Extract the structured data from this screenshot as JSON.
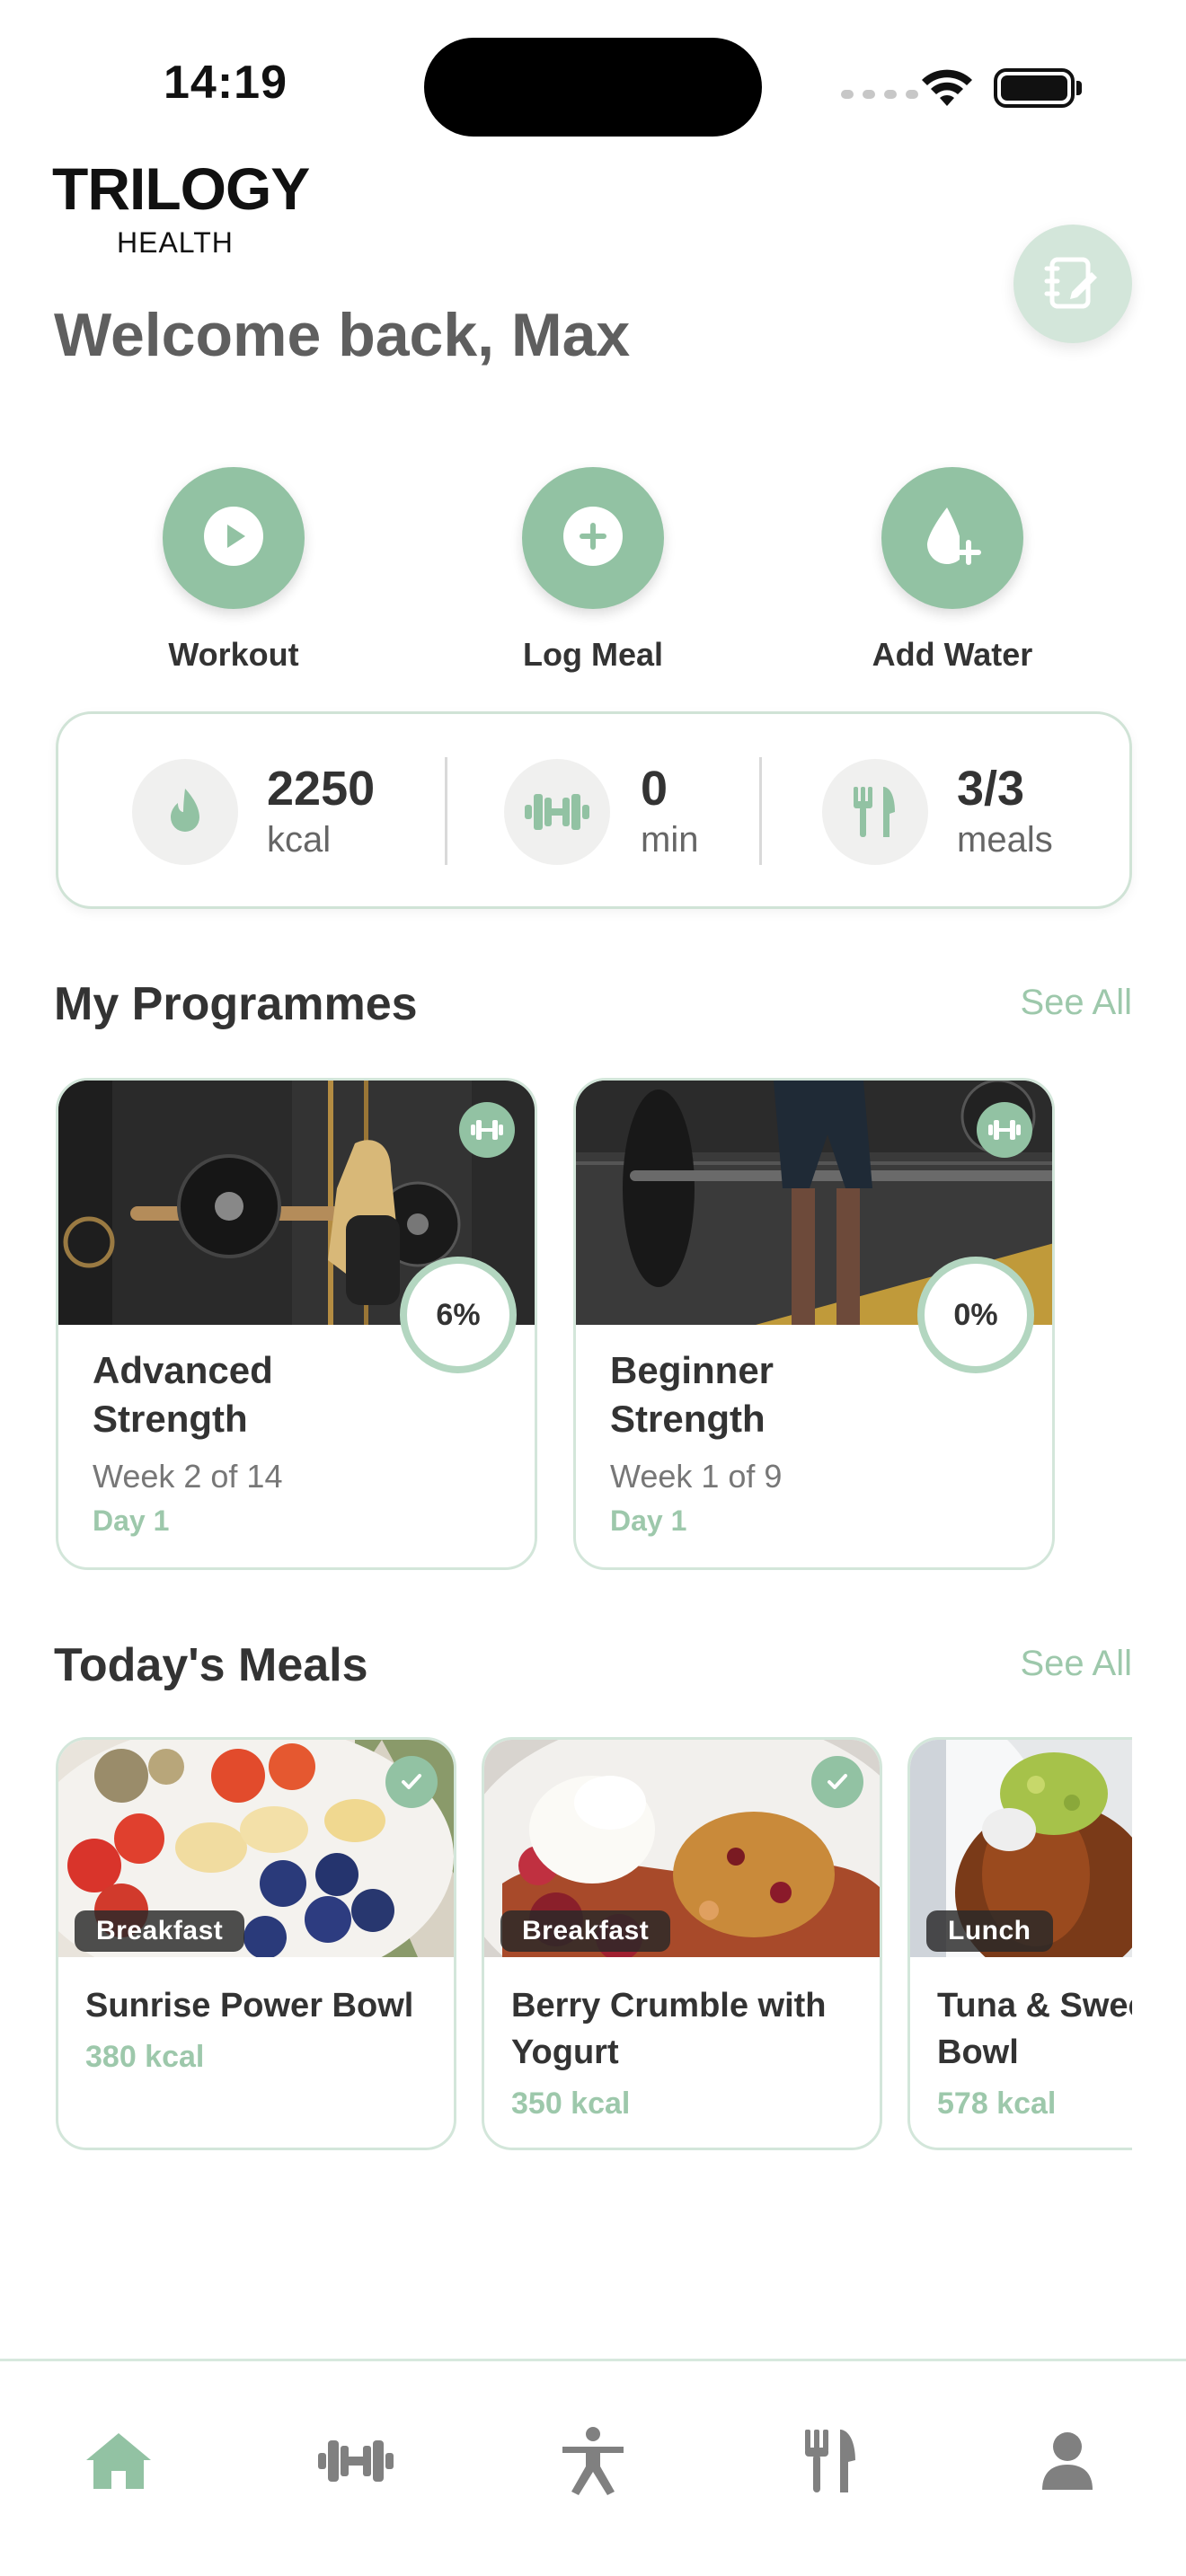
{
  "status": {
    "time": "14:19"
  },
  "brand": {
    "name": "TRILOGY",
    "sub": "HEALTH"
  },
  "header": {
    "welcome": "Welcome back, Max",
    "notes_icon": "notebook-edit-icon"
  },
  "quick_actions": [
    {
      "label": "Workout",
      "icon": "play-icon"
    },
    {
      "label": "Log Meal",
      "icon": "plus-icon"
    },
    {
      "label": "Add Water",
      "icon": "water-drop-plus-icon"
    }
  ],
  "stats": [
    {
      "value": "2250",
      "unit": "kcal",
      "icon": "flame-icon"
    },
    {
      "value": "0",
      "unit": "min",
      "icon": "dumbbell-icon"
    },
    {
      "value": "3/3",
      "unit": "meals",
      "icon": "cutlery-icon"
    }
  ],
  "programmes": {
    "title": "My Programmes",
    "see_all": "See All",
    "items": [
      {
        "title": "Advanced Strength",
        "progress": "6%",
        "week": "Week 2 of 14",
        "day": "Day 1"
      },
      {
        "title": "Beginner Strength",
        "progress": "0%",
        "week": "Week 1 of 9",
        "day": "Day 1"
      }
    ]
  },
  "meals": {
    "title": "Today's Meals",
    "see_all": "See All",
    "items": [
      {
        "tag": "Breakfast",
        "name": "Sunrise Power Bowl",
        "kcal": "380 kcal",
        "completed": true
      },
      {
        "tag": "Breakfast",
        "name": "Berry Crumble with Yogurt",
        "kcal": "350 kcal",
        "completed": true
      },
      {
        "tag": "Lunch",
        "name": "Tuna & Sweet Potato Bowl",
        "kcal": "578 kcal",
        "completed": false
      }
    ]
  },
  "tabbar": {
    "items": [
      {
        "icon": "home-icon",
        "active": true
      },
      {
        "icon": "dumbbell-icon",
        "active": false
      },
      {
        "icon": "exercise-figure-icon",
        "active": false
      },
      {
        "icon": "cutlery-icon",
        "active": false
      },
      {
        "icon": "profile-icon",
        "active": false
      }
    ]
  },
  "colors": {
    "accent": "#92c2a3",
    "accent_light": "#d3e6da",
    "text": "#333333",
    "see_all": "#9dc8ab"
  }
}
